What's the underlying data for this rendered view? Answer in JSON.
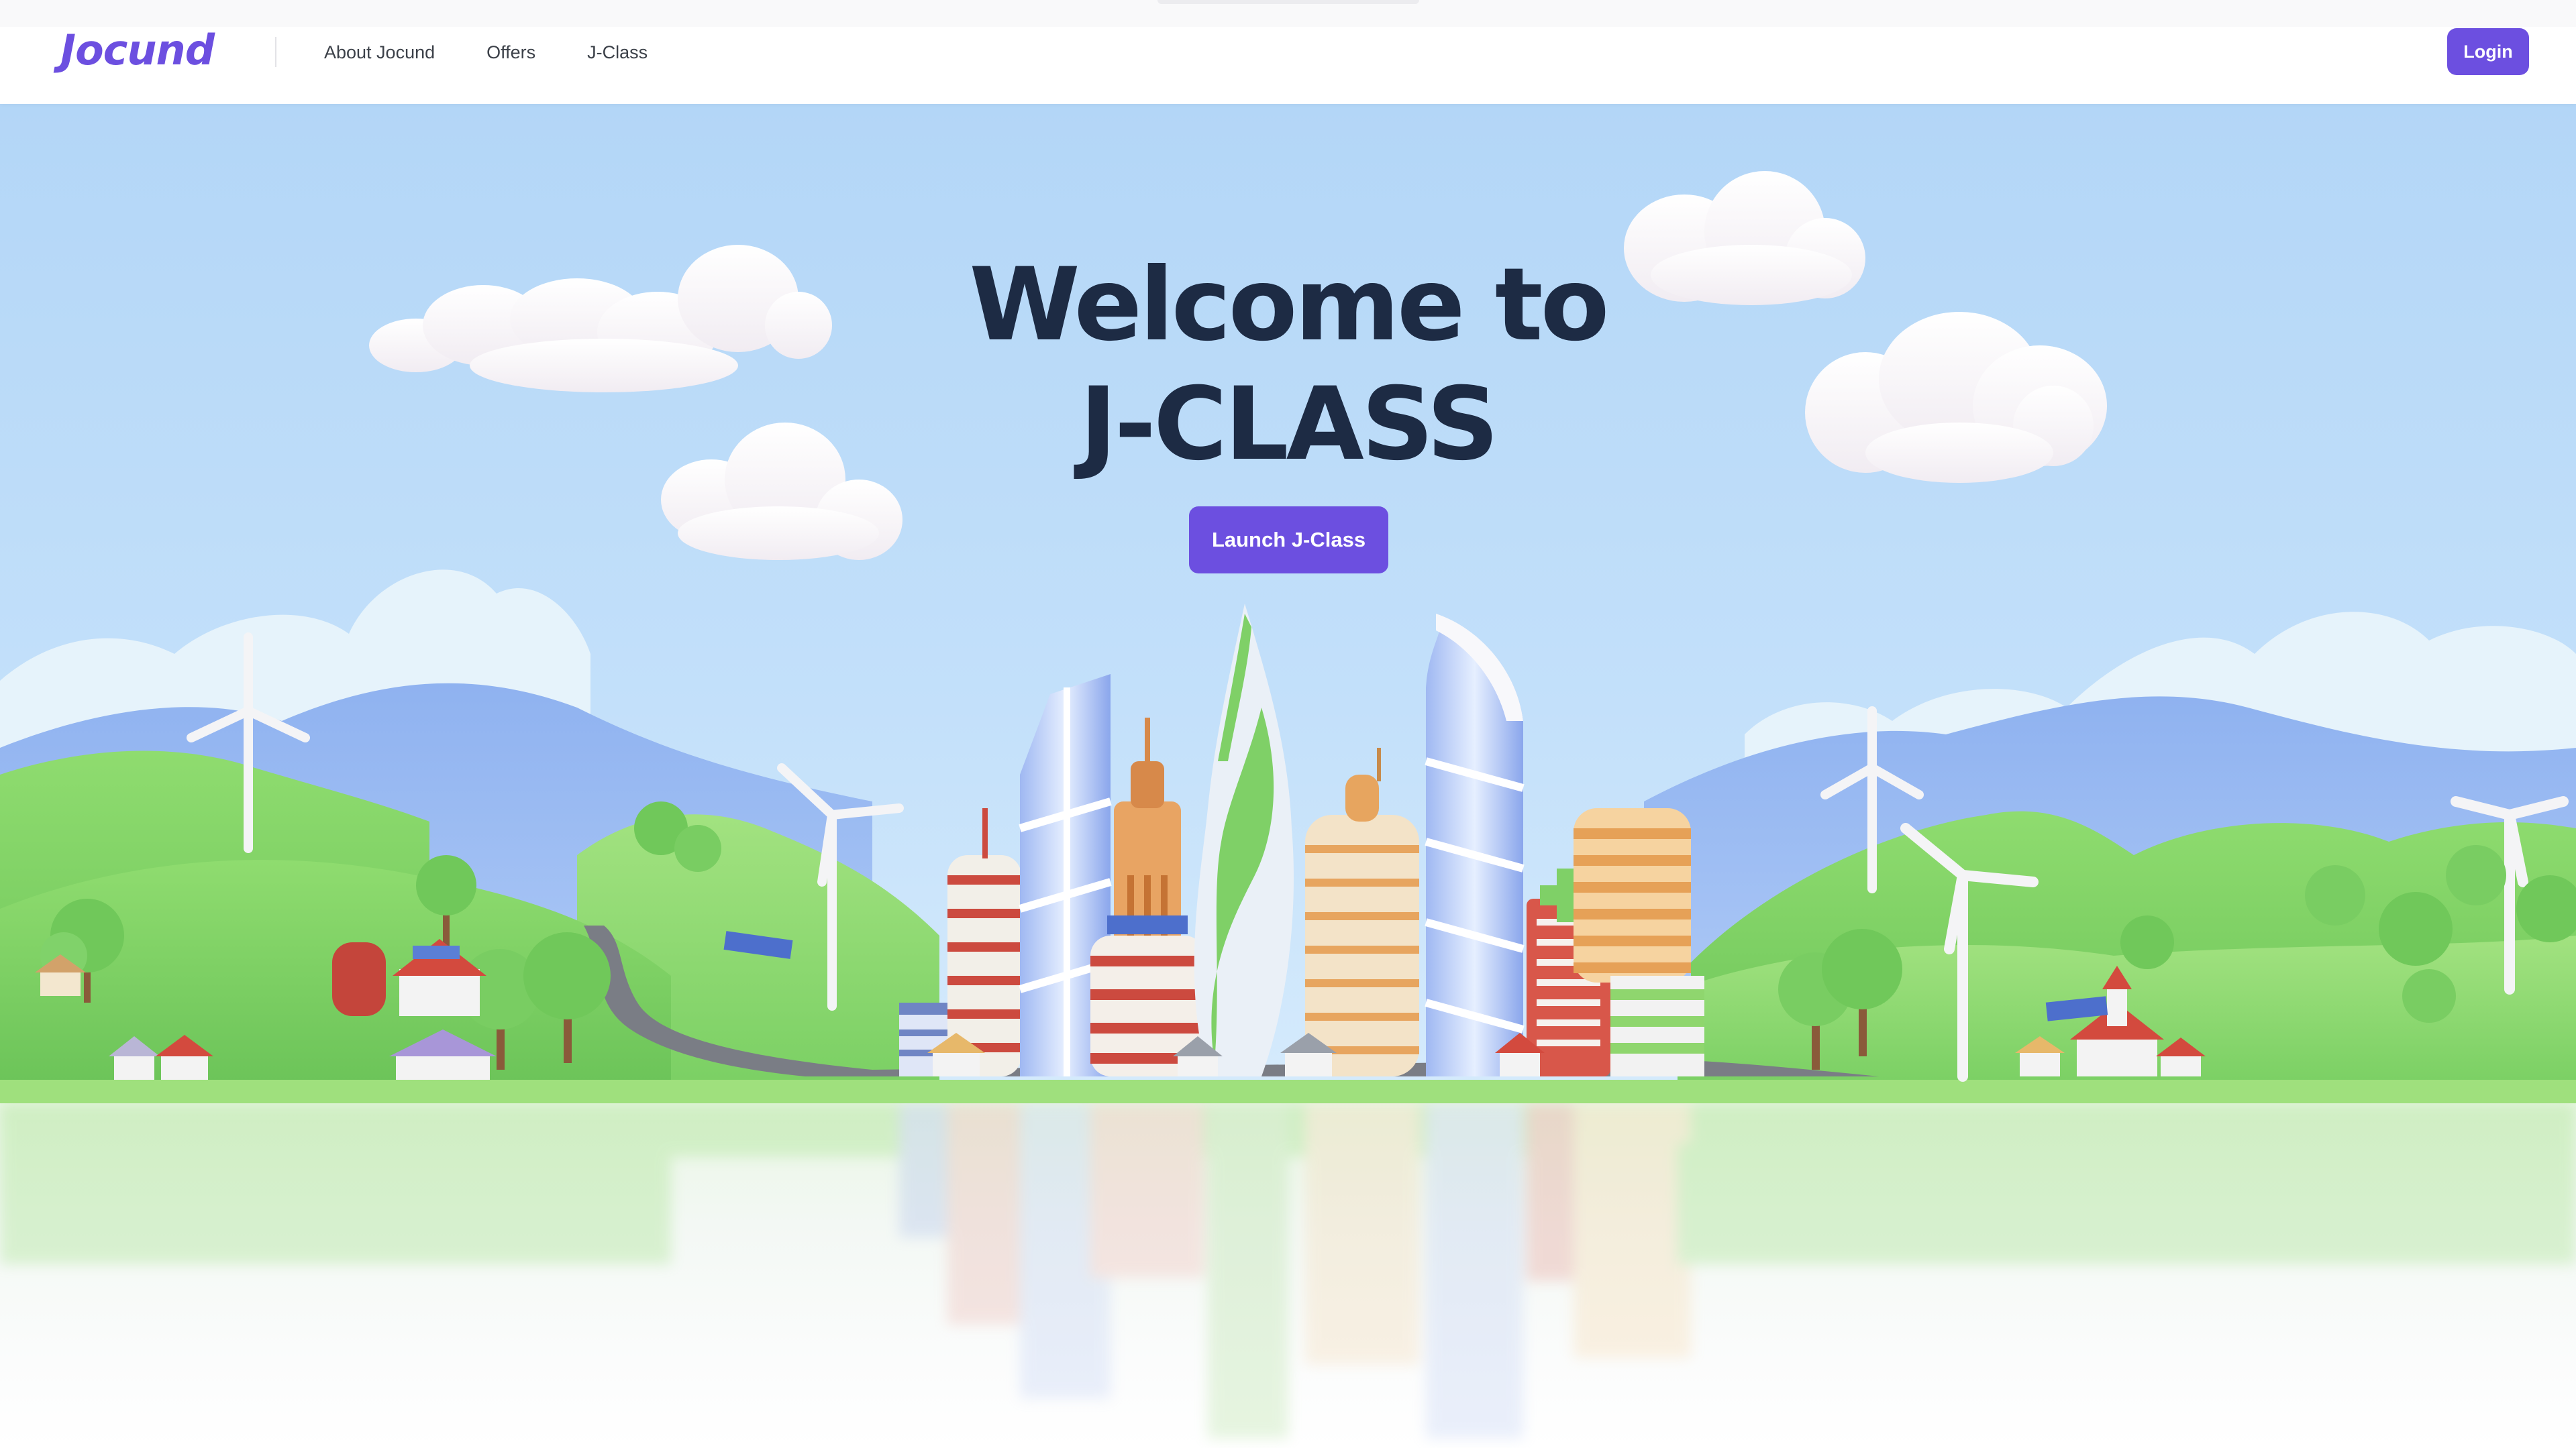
{
  "navbar": {
    "logo_text": "Jocund",
    "links": [
      {
        "label": "About Jocund"
      },
      {
        "label": "Offers"
      },
      {
        "label": "J-Class"
      }
    ],
    "login_label": "Login"
  },
  "hero": {
    "title_line1": "Welcome to",
    "title_line2": "J-CLASS",
    "cta_label": "Launch J-Class"
  },
  "colors": {
    "brand_purple": "#6c4fe0",
    "heading_navy": "#1d2b44",
    "sky_blue": "#b6d8f8",
    "grass_green": "#7ccf62"
  },
  "illustration": {
    "subject": "cartoon-city-skyline",
    "elements": [
      "clouds",
      "wind-turbines",
      "skyscrapers",
      "hills",
      "trees",
      "houses",
      "solar-panels"
    ]
  }
}
